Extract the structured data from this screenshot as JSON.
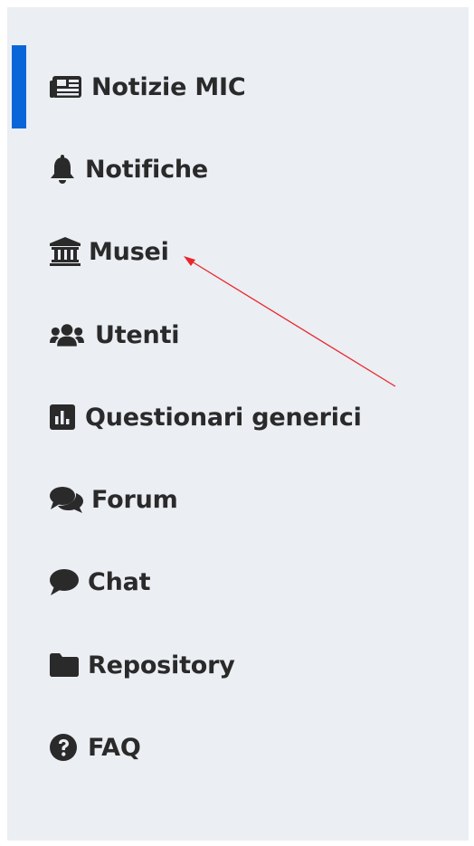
{
  "sidebar": {
    "accent_color": "#0a66d8",
    "background": "#ebeef3",
    "active_index": 0,
    "items": [
      {
        "label": "Notizie MIC",
        "icon": "newspaper-icon"
      },
      {
        "label": "Notifiche",
        "icon": "bell-icon"
      },
      {
        "label": "Musei",
        "icon": "museum-icon"
      },
      {
        "label": "Utenti",
        "icon": "users-icon"
      },
      {
        "label": "Questionari generici",
        "icon": "chart-bar-icon"
      },
      {
        "label": "Forum",
        "icon": "comments-icon"
      },
      {
        "label": "Chat",
        "icon": "comment-icon"
      },
      {
        "label": "Repository",
        "icon": "folder-icon"
      },
      {
        "label": "FAQ",
        "icon": "question-circle-icon"
      }
    ]
  },
  "annotation": {
    "color": "#e8262a",
    "points_to": "Musei"
  }
}
